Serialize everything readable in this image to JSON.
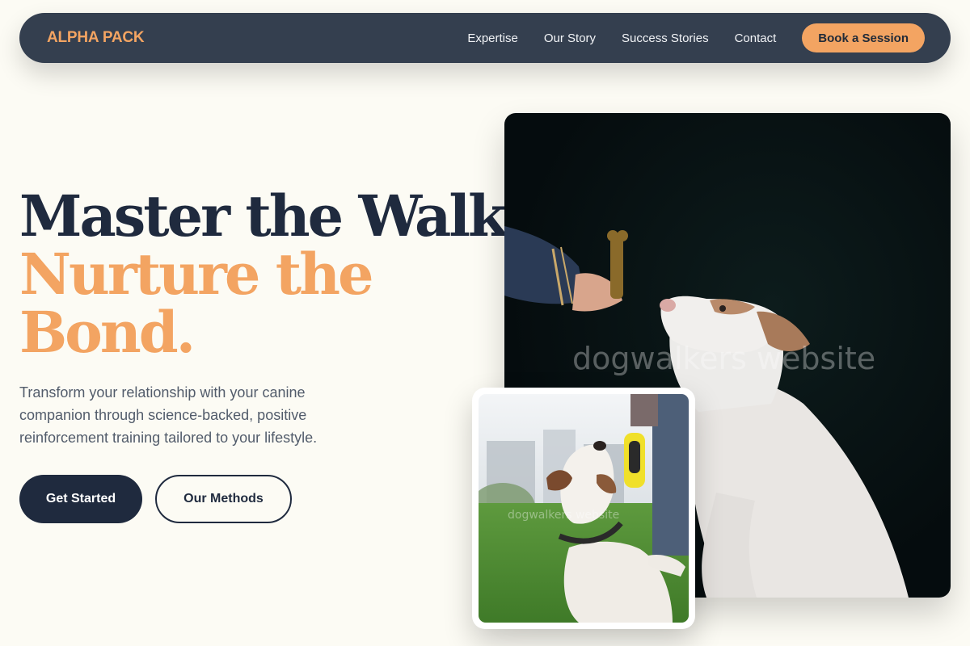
{
  "header": {
    "brand": "ALPHA PACK",
    "nav": [
      "Expertise",
      "Our Story",
      "Success Stories",
      "Contact"
    ],
    "cta": "Book a Session"
  },
  "hero": {
    "headline_line1": "Master the Walk,",
    "headline_line2": "Nurture the",
    "headline_line3": "Bond.",
    "subtitle": "Transform your relationship with your canine companion through science-backed, positive reinforcement training tailored to your lifestyle.",
    "primary_button": "Get Started",
    "secondary_button": "Our Methods"
  },
  "images": {
    "main_watermark": "dogwalkers website",
    "inset_watermark": "dogwalkers website"
  },
  "colors": {
    "background": "#fcfbf4",
    "navbar": "#343f4f",
    "accent": "#f3a462",
    "headline_dark": "#1f2a3e",
    "body_text": "#525c6b"
  }
}
